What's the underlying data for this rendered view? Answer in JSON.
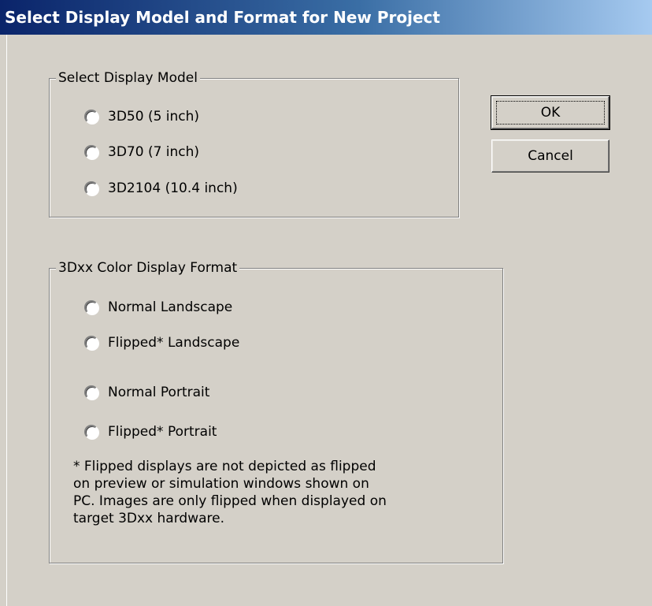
{
  "window": {
    "title": "Select Display Model and Format for New Project"
  },
  "model_group": {
    "legend": "Select Display Model",
    "options": [
      {
        "label": "3D50 (5 inch)"
      },
      {
        "label": "3D70 (7 inch)"
      },
      {
        "label": "3D2104 (10.4 inch)"
      }
    ]
  },
  "format_group": {
    "legend": "3Dxx Color Display Format",
    "options": [
      {
        "label": "Normal Landscape"
      },
      {
        "label": "Flipped* Landscape"
      },
      {
        "label": "Normal Portrait"
      },
      {
        "label": "Flipped* Portrait"
      }
    ],
    "note": "* Flipped displays are not depicted as flipped\non preview or simulation windows shown on\nPC. Images are only flipped when displayed on\ntarget 3Dxx hardware."
  },
  "buttons": {
    "ok_label": "OK",
    "cancel_label": "Cancel"
  }
}
